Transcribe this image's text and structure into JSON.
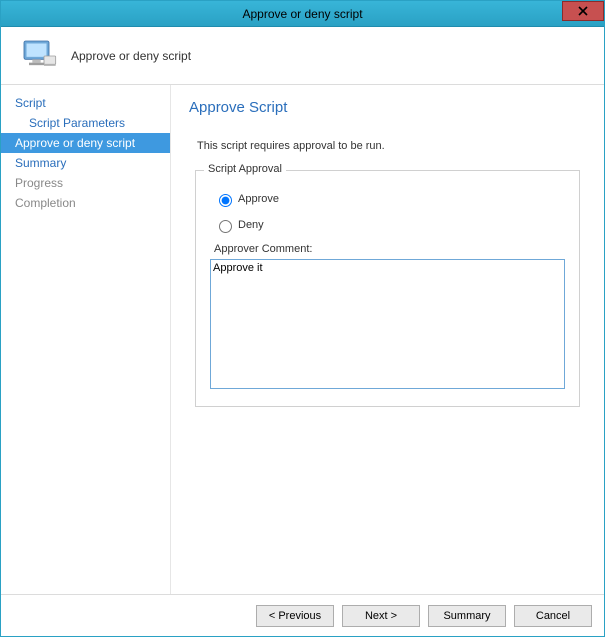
{
  "window": {
    "title": "Approve or deny script"
  },
  "header": {
    "title": "Approve or deny script"
  },
  "sidebar": {
    "items": [
      {
        "label": "Script",
        "sub": false,
        "active": false,
        "disabled": false
      },
      {
        "label": "Script Parameters",
        "sub": true,
        "active": false,
        "disabled": false
      },
      {
        "label": "Approve or deny script",
        "sub": false,
        "active": true,
        "disabled": false
      },
      {
        "label": "Summary",
        "sub": false,
        "active": false,
        "disabled": false
      },
      {
        "label": "Progress",
        "sub": false,
        "active": false,
        "disabled": true
      },
      {
        "label": "Completion",
        "sub": false,
        "active": false,
        "disabled": true
      }
    ]
  },
  "content": {
    "page_title": "Approve Script",
    "instruction": "This script requires approval to be run.",
    "fieldset_legend": "Script Approval",
    "radio_approve": "Approve",
    "radio_deny": "Deny",
    "selected_radio": "approve",
    "comment_label": "Approver Comment:",
    "comment_value": "Approve it"
  },
  "footer": {
    "previous": "< Previous",
    "next": "Next >",
    "summary": "Summary",
    "cancel": "Cancel"
  }
}
